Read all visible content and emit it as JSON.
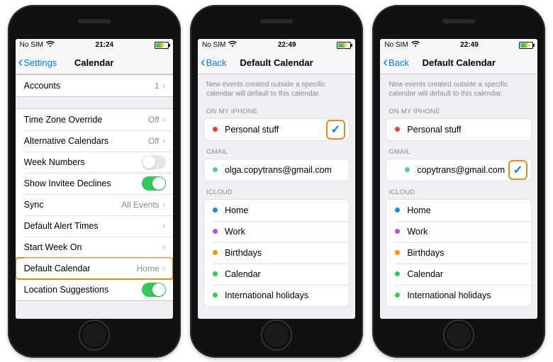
{
  "colors": {
    "accent": "#007aff",
    "switch_on": "#34c759",
    "highlight": "#e28b1c",
    "dot_red": "#ff3b30",
    "dot_teal": "#5ac8a7",
    "dot_blue": "#1e88e5",
    "dot_purple": "#a259d9",
    "dot_orange": "#ff9500",
    "dot_green": "#34c759"
  },
  "phone1": {
    "status": {
      "carrier": "No SIM",
      "time": "21:24"
    },
    "nav": {
      "back": "Settings",
      "title": "Calendar"
    },
    "sections": [
      {
        "rows": [
          {
            "label": "Accounts",
            "value": "1",
            "chevron": true
          }
        ]
      },
      {
        "rows": [
          {
            "label": "Time Zone Override",
            "value": "Off",
            "chevron": true
          },
          {
            "label": "Alternative Calendars",
            "value": "Off",
            "chevron": true
          },
          {
            "label": "Week Numbers",
            "switch": false
          },
          {
            "label": "Show Invitee Declines",
            "switch": true
          },
          {
            "label": "Sync",
            "value": "All Events",
            "chevron": true
          },
          {
            "label": "Default Alert Times",
            "chevron": true
          },
          {
            "label": "Start Week On",
            "chevron": true
          },
          {
            "label": "Default Calendar",
            "value": "Home",
            "chevron": true,
            "highlight": true
          },
          {
            "label": "Location Suggestions",
            "switch": true
          }
        ]
      }
    ]
  },
  "phone2": {
    "status": {
      "carrier": "No SIM",
      "time": "22:49"
    },
    "nav": {
      "back": "Back",
      "title": "Default Calendar"
    },
    "note": "New events created outside a specific calendar will default to this calendar.",
    "groups": [
      {
        "header": "ON MY IPHONE",
        "items": [
          {
            "dot": "dot_red",
            "label": "Personal stuff",
            "checked": true,
            "highlight_check": true
          }
        ]
      },
      {
        "header": "GMAIL",
        "items": [
          {
            "dot": "dot_teal",
            "label": "olga.copytrans@gmail.com"
          }
        ]
      },
      {
        "header": "ICLOUD",
        "items": [
          {
            "dot": "dot_blue",
            "label": "Home"
          },
          {
            "dot": "dot_purple",
            "label": "Work"
          },
          {
            "dot": "dot_orange",
            "label": "Birthdays"
          },
          {
            "dot": "dot_green",
            "label": "Calendar"
          },
          {
            "dot": "dot_green",
            "label": "International holidays"
          }
        ]
      }
    ]
  },
  "phone3": {
    "status": {
      "carrier": "No SIM",
      "time": "22:49"
    },
    "nav": {
      "back": "Back",
      "title": "Default Calendar"
    },
    "note": "New events created outside a specific calendar will default to this calendar.",
    "groups": [
      {
        "header": "ON MY IPHONE",
        "items": [
          {
            "dot": "dot_red",
            "label": "Personal stuff"
          }
        ]
      },
      {
        "header": "GMAIL",
        "items": [
          {
            "dot": "dot_teal",
            "label": "copytrans@gmail.com",
            "indent": true,
            "checked": true,
            "highlight_check": true
          }
        ]
      },
      {
        "header": "ICLOUD",
        "items": [
          {
            "dot": "dot_blue",
            "label": "Home"
          },
          {
            "dot": "dot_purple",
            "label": "Work"
          },
          {
            "dot": "dot_orange",
            "label": "Birthdays"
          },
          {
            "dot": "dot_green",
            "label": "Calendar"
          },
          {
            "dot": "dot_green",
            "label": "International holidays"
          }
        ]
      }
    ]
  }
}
